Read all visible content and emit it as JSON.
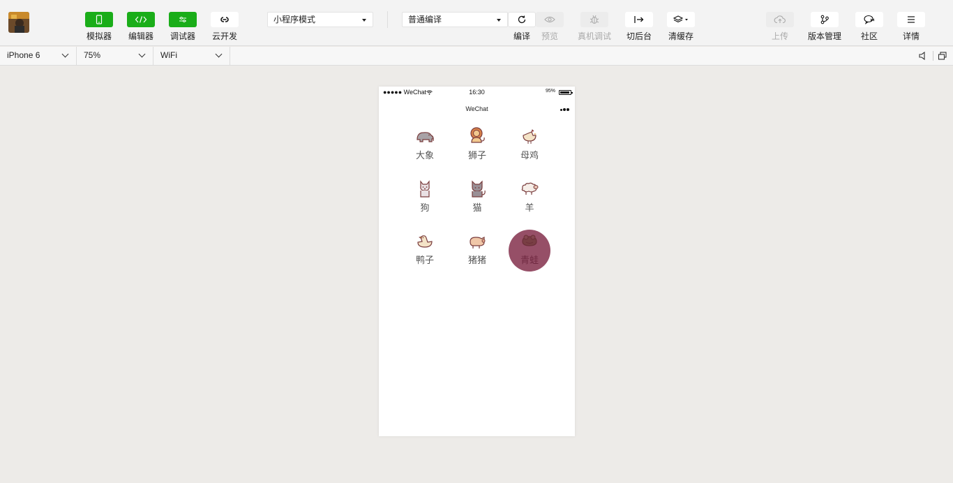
{
  "toolbar": {
    "simulator_label": "模拟器",
    "editor_label": "编辑器",
    "debugger_label": "调试器",
    "cloud_label": "云开发",
    "mode_select": "小程序模式",
    "compile_select": "普通编译",
    "compile_label": "编译",
    "preview_label": "预览",
    "device_debug_label": "真机调试",
    "switch_bg_label": "切后台",
    "clear_cache_label": "清缓存",
    "upload_label": "上传",
    "version_label": "版本管理",
    "community_label": "社区",
    "details_label": "详情"
  },
  "subbar": {
    "device": "iPhone 6",
    "zoom": "75%",
    "network": "WiFi"
  },
  "phone": {
    "status_left": "●●●●● WeChat",
    "time": "16:30",
    "battery": "95%",
    "title": "WeChat"
  },
  "animals": [
    {
      "name": "大象",
      "icon": "elephant-icon"
    },
    {
      "name": "狮子",
      "icon": "lion-icon"
    },
    {
      "name": "母鸡",
      "icon": "hen-icon"
    },
    {
      "name": "狗",
      "icon": "dog-icon"
    },
    {
      "name": "猫",
      "icon": "cat-icon"
    },
    {
      "name": "羊",
      "icon": "sheep-icon"
    },
    {
      "name": "鸭子",
      "icon": "duck-icon"
    },
    {
      "name": "猪猪",
      "icon": "pig-icon"
    },
    {
      "name": "青蛙",
      "icon": "frog-icon"
    }
  ],
  "colors": {
    "accent_green": "#1aad19",
    "ripple": "#7a1e3c",
    "icon_outline": "#7a3d3d"
  }
}
